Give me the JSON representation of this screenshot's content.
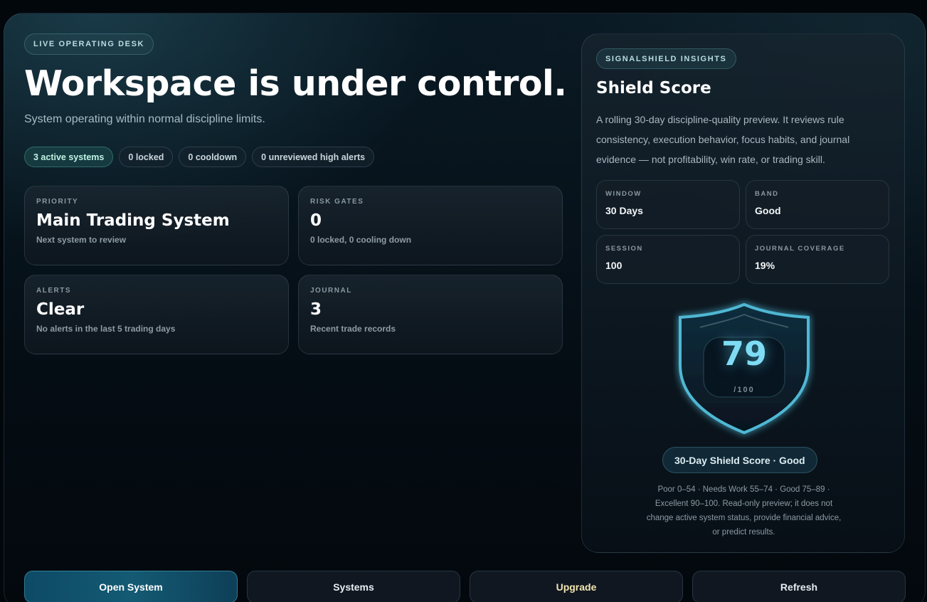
{
  "hero": {
    "eyebrow": "LIVE OPERATING DESK",
    "title": "Workspace is under control.",
    "subtitle": "System operating within normal discipline limits."
  },
  "chips": [
    {
      "label": "3 active systems",
      "active": true
    },
    {
      "label": "0 locked"
    },
    {
      "label": "0 cooldown"
    },
    {
      "label": "0 unreviewed high alerts"
    }
  ],
  "cards": {
    "priority": {
      "label": "PRIORITY",
      "value": "Main Trading System",
      "desc": "Next system to review"
    },
    "risk": {
      "label": "RISK GATES",
      "value": "0",
      "desc": "0 locked, 0 cooling down"
    },
    "alerts": {
      "label": "ALERTS",
      "value": "Clear",
      "desc": "No alerts in the last 5 trading days"
    },
    "journal": {
      "label": "JOURNAL",
      "value": "3",
      "desc": "Recent trade records"
    }
  },
  "insights": {
    "eyebrow": "SIGNALSHIELD INSIGHTS",
    "title": "Shield Score",
    "description": "A rolling 30-day discipline-quality preview. It reviews rule consistency, execution behavior, focus habits, and journal evidence — not profitability, win rate, or trading skill.",
    "stats": {
      "window": {
        "label": "WINDOW",
        "value": "30 Days"
      },
      "band": {
        "label": "BAND",
        "value": "Good"
      },
      "session": {
        "label": "SESSION",
        "value": "100"
      },
      "coverage": {
        "label": "JOURNAL COVERAGE",
        "value": "19%"
      }
    },
    "score": "79",
    "score_max": "/100",
    "badge": "30-Day Shield Score · Good",
    "note": "Poor 0–54 · Needs Work 55–74 · Good 75–89 · Excellent 90–100. Read-only preview; it does not change active system status, provide financial advice, or predict results."
  },
  "actions": {
    "open": "Open System",
    "systems": "Systems",
    "upgrade": "Upgrade",
    "refresh": "Refresh"
  },
  "colors": {
    "accent": "#5ec8e0",
    "score": "#7fdcf5",
    "upgrade_text": "#f3e6b2"
  }
}
